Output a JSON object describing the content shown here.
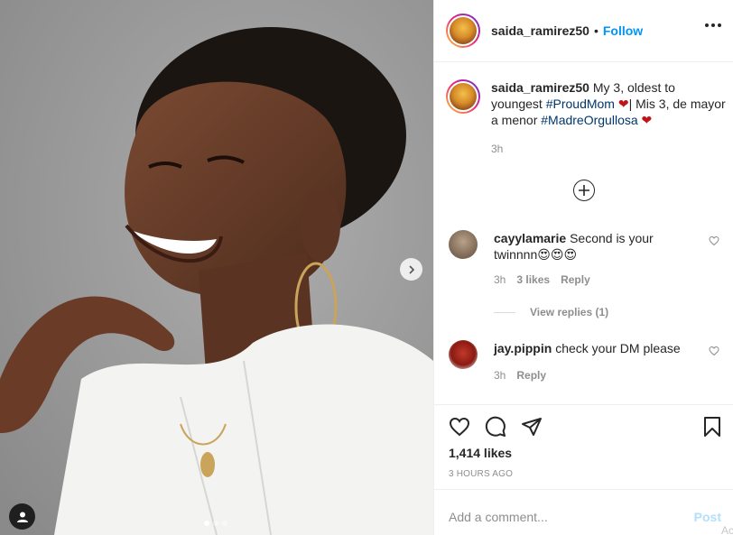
{
  "post": {
    "username": "saida_ramirez50",
    "follow_label": "Follow",
    "separator": "•",
    "caption": {
      "username": "saida_ramirez50",
      "text_part1": "My 3, oldest to youngest ",
      "hashtag1": "#ProudMom",
      "heart1": "❤",
      "text_part2": "| Mis 3, de mayor a menor ",
      "hashtag2": "#MadreOrgullosa",
      "heart2": "❤",
      "time": "3h"
    },
    "carousel": {
      "slides": 3,
      "active": 1
    },
    "comments": [
      {
        "username": "cayylamarie",
        "text": "Second is your twinnnn😍😍😍",
        "time": "3h",
        "likes": "3 likes",
        "reply_label": "Reply",
        "view_replies": "View replies (1)"
      },
      {
        "username": "jay.pippin",
        "text": "check your DM please",
        "time": "3h",
        "reply_label": "Reply"
      }
    ],
    "likes": "1,414 likes",
    "posted_time": "3 HOURS AGO",
    "add_comment_placeholder": "Add a comment...",
    "post_label": "Post",
    "ad_fragment": "Ac"
  },
  "icons": {
    "heart": "heart-icon",
    "comment": "comment-icon",
    "share": "share-icon",
    "save": "bookmark-icon",
    "more": "more-options-icon",
    "next": "chevron-right-icon",
    "user_tag": "user-tag-icon",
    "load_more": "plus-circle-icon"
  },
  "colors": {
    "accent": "#0095f6",
    "hashtag": "#00376b",
    "muted": "#8e8e8e",
    "post_disabled": "#b2dffc"
  }
}
